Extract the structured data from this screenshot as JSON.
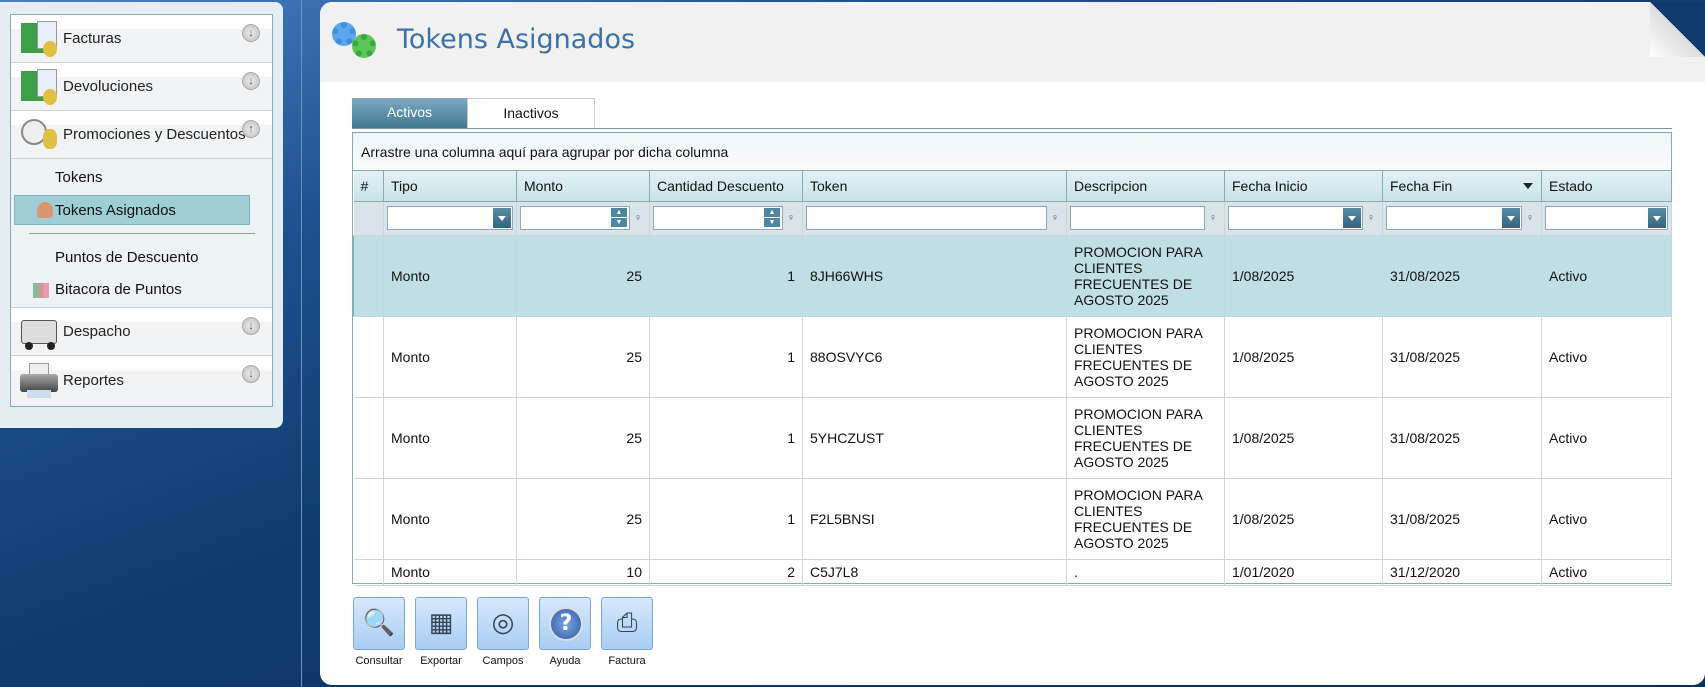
{
  "sidebar": {
    "groups": [
      {
        "label": "Facturas",
        "icon": "invoice-coins-icon",
        "expanded": false
      },
      {
        "label": "Devoluciones",
        "icon": "return-coins-icon",
        "expanded": false
      },
      {
        "label": "Promociones y Descuentos",
        "icon": "clock-coins-icon",
        "expanded": true
      },
      {
        "label": "Despacho",
        "icon": "delivery-truck-icon",
        "expanded": false
      },
      {
        "label": "Reportes",
        "icon": "printer-icon",
        "expanded": false
      }
    ],
    "subitems": [
      {
        "label": "Tokens"
      },
      {
        "label": "Tokens Asignados",
        "selected": true
      },
      {
        "label": "Puntos de Descuento"
      },
      {
        "label": "Bitacora de Puntos"
      }
    ]
  },
  "page": {
    "title": "Tokens Asignados"
  },
  "tabs": [
    {
      "label": "Activos",
      "active": true
    },
    {
      "label": "Inactivos",
      "active": false
    }
  ],
  "grid": {
    "group_panel": "Arrastre una columna aquí para agrupar por dicha columna",
    "columns": [
      "#",
      "Tipo",
      "Monto",
      "Cantidad Descuento",
      "Token",
      "Descripcion",
      "Fecha Inicio",
      "Fecha Fin",
      "Estado"
    ],
    "sorted_column": "Fecha Fin",
    "rows": [
      {
        "tipo": "Monto",
        "monto": "25",
        "cantidad": "1",
        "token": "8JH66WHS",
        "descripcion": "PROMOCION PARA CLIENTES FRECUENTES DE AGOSTO 2025",
        "inicio": "1/08/2025",
        "fin": "31/08/2025",
        "estado": "Activo",
        "selected": true
      },
      {
        "tipo": "Monto",
        "monto": "25",
        "cantidad": "1",
        "token": "88OSVYC6",
        "descripcion": "PROMOCION PARA CLIENTES FRECUENTES DE AGOSTO 2025",
        "inicio": "1/08/2025",
        "fin": "31/08/2025",
        "estado": "Activo"
      },
      {
        "tipo": "Monto",
        "monto": "25",
        "cantidad": "1",
        "token": "5YHCZUST",
        "descripcion": "PROMOCION PARA CLIENTES FRECUENTES DE AGOSTO 2025",
        "inicio": "1/08/2025",
        "fin": "31/08/2025",
        "estado": "Activo"
      },
      {
        "tipo": "Monto",
        "monto": "25",
        "cantidad": "1",
        "token": "F2L5BNSI",
        "descripcion": "PROMOCION PARA CLIENTES FRECUENTES DE AGOSTO 2025",
        "inicio": "1/08/2025",
        "fin": "31/08/2025",
        "estado": "Activo"
      },
      {
        "tipo": "Monto",
        "monto": "10",
        "cantidad": "2",
        "token": "C5J7L8",
        "descripcion": ".",
        "inicio": "1/01/2020",
        "fin": "31/12/2020",
        "estado": "Activo"
      }
    ]
  },
  "toolbar": [
    {
      "label": "Consultar",
      "icon": "search-document-icon"
    },
    {
      "label": "Exportar",
      "icon": "export-spreadsheet-icon"
    },
    {
      "label": "Campos",
      "icon": "binoculars-icon"
    },
    {
      "label": "Ayuda",
      "icon": "help-icon"
    },
    {
      "label": "Factura",
      "icon": "printer-icon"
    }
  ],
  "colors": {
    "title": "#3b72ab",
    "selected_row": "#bfdfe5",
    "tab_active": "#3f7891",
    "background": "#0f3b6e"
  }
}
